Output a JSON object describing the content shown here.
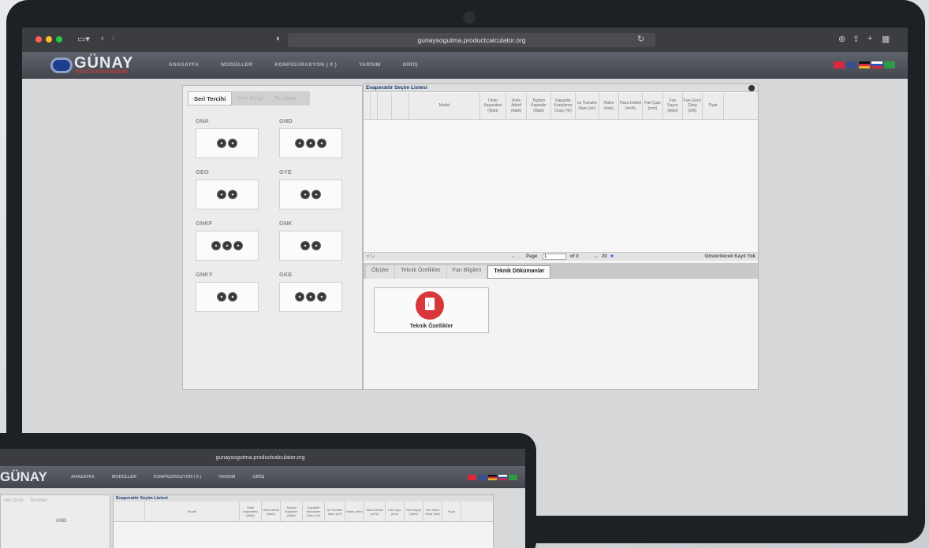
{
  "browser": {
    "url": "gunaysogutma.productcalculator.org"
  },
  "site": {
    "brand": "GÜNAY",
    "brand_sub": "HEAT EXCHANGERS",
    "nav": [
      "ANASAYFA",
      "MODÜLLER",
      "KONFİGÜRASYON ( 0 )",
      "YARDIM",
      "GİRİŞ"
    ],
    "flags": [
      {
        "name": "turkish-flag",
        "color": "#d8283c"
      },
      {
        "name": "uk-flag",
        "color": "#3b4f8f"
      },
      {
        "name": "german-flag",
        "color": "#e5b42b"
      },
      {
        "name": "russian-flag",
        "color": "#2f55b6"
      },
      {
        "name": "saudi-flag",
        "color": "#2e9a48"
      }
    ]
  },
  "left_panel": {
    "tabs": [
      "Seri Tercihi",
      "Veri Girişi",
      "Tercihler"
    ],
    "products": [
      "GNA",
      "GND",
      "GEO",
      "GYE",
      "GNKF",
      "GNK",
      "GNKY",
      "GKE"
    ]
  },
  "grid": {
    "title": "Evaporatör Seçim Listesi",
    "columns": [
      "Model",
      "Ünite Kapasitesi (Watt)",
      "Ünite Adedi (Adet)",
      "Toplam Kapasite (Watt)",
      "Kapasite Karşılama Oranı (%)",
      "Isı Transfer Alanı (m²)",
      "Hatve (mm)",
      "Hava Debisi (m³/h)",
      "Fan Çapı (mm)",
      "Fan Sayısı (Adet)",
      "Fan Gücü Girişi (kW)",
      "Fiyat"
    ],
    "pager": {
      "page_label": "Page",
      "page_value": "1",
      "of_label": "of 0",
      "page_size": "20",
      "status": "Gösterilecek Kayıt Yok"
    }
  },
  "detail_tabs": [
    "Ölçüler",
    "Teknik Özellikler",
    "Fan Bilgileri",
    "Teknik Dökümanlar"
  ],
  "document": {
    "label": "Teknik Özellikler"
  },
  "second_view": {
    "url": "gunaysogutma.productcalculator.org",
    "brand": "GÜNAY",
    "nav": [
      "ANASAYFA",
      "MODÜLLER",
      "KONFİGÜRASYON ( 0 )",
      "YARDIM",
      "GİRİŞ"
    ],
    "tabs": [
      "Veri Girişi",
      "Tercihler"
    ],
    "product": "GND",
    "grid_title": "Evaporatör Seçim Listesi"
  }
}
